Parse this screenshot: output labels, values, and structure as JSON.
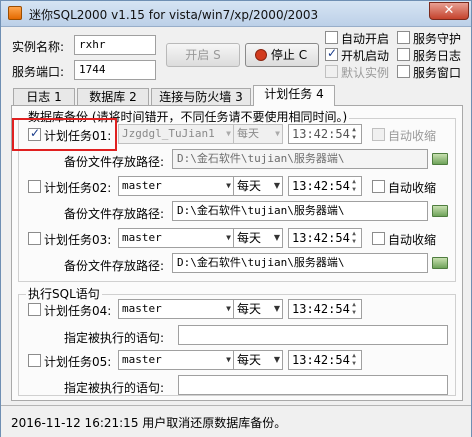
{
  "window": {
    "title": "迷你SQL2000 v1.15 for vista/win7/xp/2000/2003",
    "close_glyph": "✕"
  },
  "top": {
    "instance_label": "实例名称:",
    "instance_value": "rxhr",
    "port_label": "服务端口:",
    "port_value": "1744",
    "start_button": "开启 S",
    "stop_button": "停止 C",
    "checkboxes": {
      "auto_start": {
        "label": "自动开启",
        "checked": false
      },
      "boot_start": {
        "label": "开机启动",
        "checked": true
      },
      "default_instance": {
        "label": "默认实例",
        "checked": false,
        "disabled": true
      },
      "service_guard": {
        "label": "服务守护",
        "checked": false
      },
      "service_log": {
        "label": "服务日志",
        "checked": false
      },
      "service_window": {
        "label": "服务窗口",
        "checked": false
      }
    }
  },
  "tabs": [
    {
      "label": "日志 1",
      "active": false
    },
    {
      "label": "数据库 2",
      "active": false
    },
    {
      "label": "连接与防火墙 3",
      "active": false
    },
    {
      "label": "计划任务 4",
      "active": true
    }
  ],
  "backup_group": {
    "title": "数据库备份 (请将时间错开，不同任务请不要使用相同时间。)",
    "path_label": "备份文件存放路径:",
    "auto_compress_label": "自动收缩",
    "tasks": [
      {
        "label": "计划任务01:",
        "checked": true,
        "database": "Jzgdgl_TuJian1",
        "frequency": "每天",
        "time": "13:42:54",
        "auto_compress": false,
        "path": "D:\\金石软件\\tujian\\服务器端\\",
        "disabled": true
      },
      {
        "label": "计划任务02:",
        "checked": false,
        "database": "master",
        "frequency": "每天",
        "time": "13:42:54",
        "auto_compress": false,
        "path": "D:\\金石软件\\tujian\\服务器端\\",
        "disabled": false
      },
      {
        "label": "计划任务03:",
        "checked": false,
        "database": "master",
        "frequency": "每天",
        "time": "13:42:54",
        "auto_compress": false,
        "path": "D:\\金石软件\\tujian\\服务器端\\",
        "disabled": false
      }
    ]
  },
  "sql_group": {
    "title": "执行SQL语句",
    "statement_label": "指定被执行的语句:",
    "tasks": [
      {
        "label": "计划任务04:",
        "checked": false,
        "database": "master",
        "frequency": "每天",
        "time": "13:42:54",
        "statement": ""
      },
      {
        "label": "计划任务05:",
        "checked": false,
        "database": "master",
        "frequency": "每天",
        "time": "13:42:54",
        "statement": ""
      }
    ]
  },
  "status": {
    "text": "2016-11-12 16:21:15 用户取消还原数据库备份。"
  },
  "icons": {
    "stop": "stop-icon",
    "folder": "folder-icon",
    "app": "app-icon"
  },
  "colors": {
    "highlight": "#e02020",
    "stop_icon": "#d23b1e"
  }
}
